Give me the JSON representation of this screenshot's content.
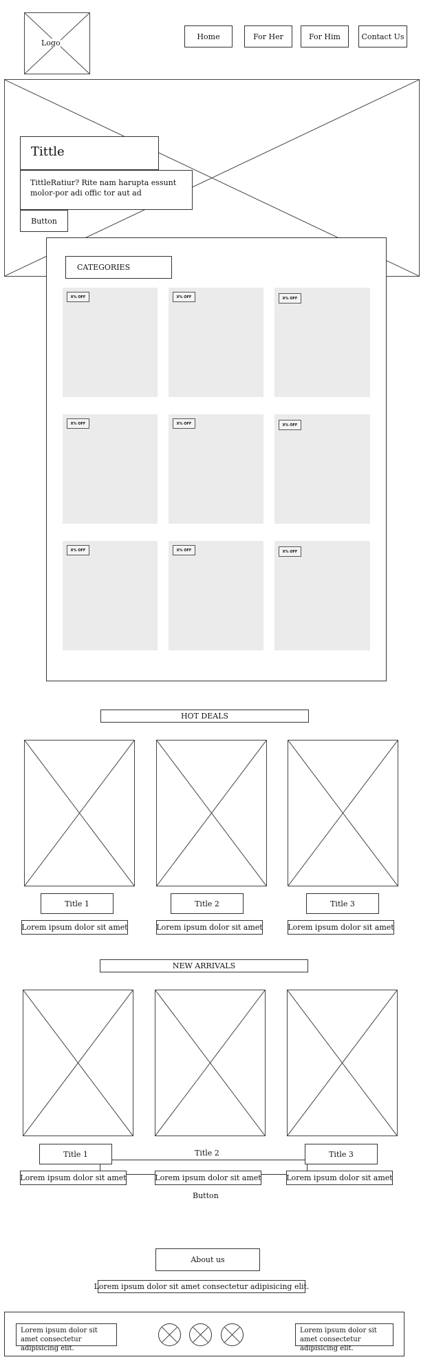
{
  "header": {
    "logo_label": "Logo",
    "nav": [
      "Home",
      "For Her",
      "For Him",
      "Contact Us"
    ]
  },
  "hero": {
    "title": "Tittle",
    "text": "TittleRatiur? Rite nam harupta essunt molor-por adi offic tor aut ad",
    "button_label": "Button"
  },
  "categories": {
    "heading": "CATEGORIES",
    "badges": [
      "X% OFF",
      "X% OFF",
      "X% OFF",
      "X% OFF",
      "X% OFF",
      "X% OFF",
      "X% OFF",
      "X% OFF",
      "X% OFF"
    ]
  },
  "hot_deals": {
    "heading": "HOT DEALS",
    "items": [
      {
        "title": "Title 1",
        "caption": "Lorem ipsum dolor sit amet"
      },
      {
        "title": "Title 2",
        "caption": "Lorem ipsum dolor sit amet"
      },
      {
        "title": "Title 3",
        "caption": "Lorem ipsum dolor sit amet"
      }
    ]
  },
  "new_arrivals": {
    "heading": "NEW ARRIVALS",
    "items": [
      {
        "title": "Title 1",
        "caption": "Lorem ipsum dolor sit amet"
      },
      {
        "title": "Title 2",
        "caption": "Lorem ipsum dolor sit amet"
      },
      {
        "title": "Title 3",
        "caption": "Lorem ipsum dolor sit amet"
      }
    ],
    "button_label": "Button"
  },
  "about": {
    "label": "About us",
    "text": "Lorem ipsum dolor sit amet consectetur adipisicing elit."
  },
  "footer": {
    "left_text": "Lorem ipsum dolor sit amet consectetur adipisicing elit.",
    "right_text": "Lorem ipsum dolor sit amet consectetur adipisicing elit."
  }
}
